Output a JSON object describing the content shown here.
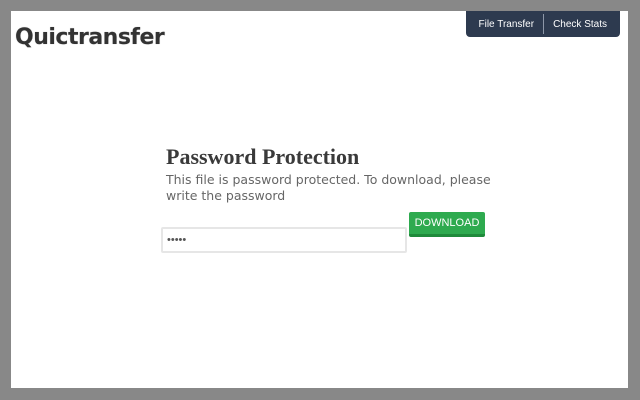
{
  "header": {
    "logo_text": "Quictransfer",
    "nav": [
      {
        "label": "File Transfer"
      },
      {
        "label": "Check Stats"
      }
    ]
  },
  "main": {
    "title": "Password Protection",
    "description": "This file is password protected. To download, please write the password",
    "password_value": "•••••",
    "download_label": "DOWNLOAD"
  },
  "colors": {
    "page_background": "#888888",
    "nav_background": "#2d3a4f",
    "download_button": "#2eaa4f"
  }
}
